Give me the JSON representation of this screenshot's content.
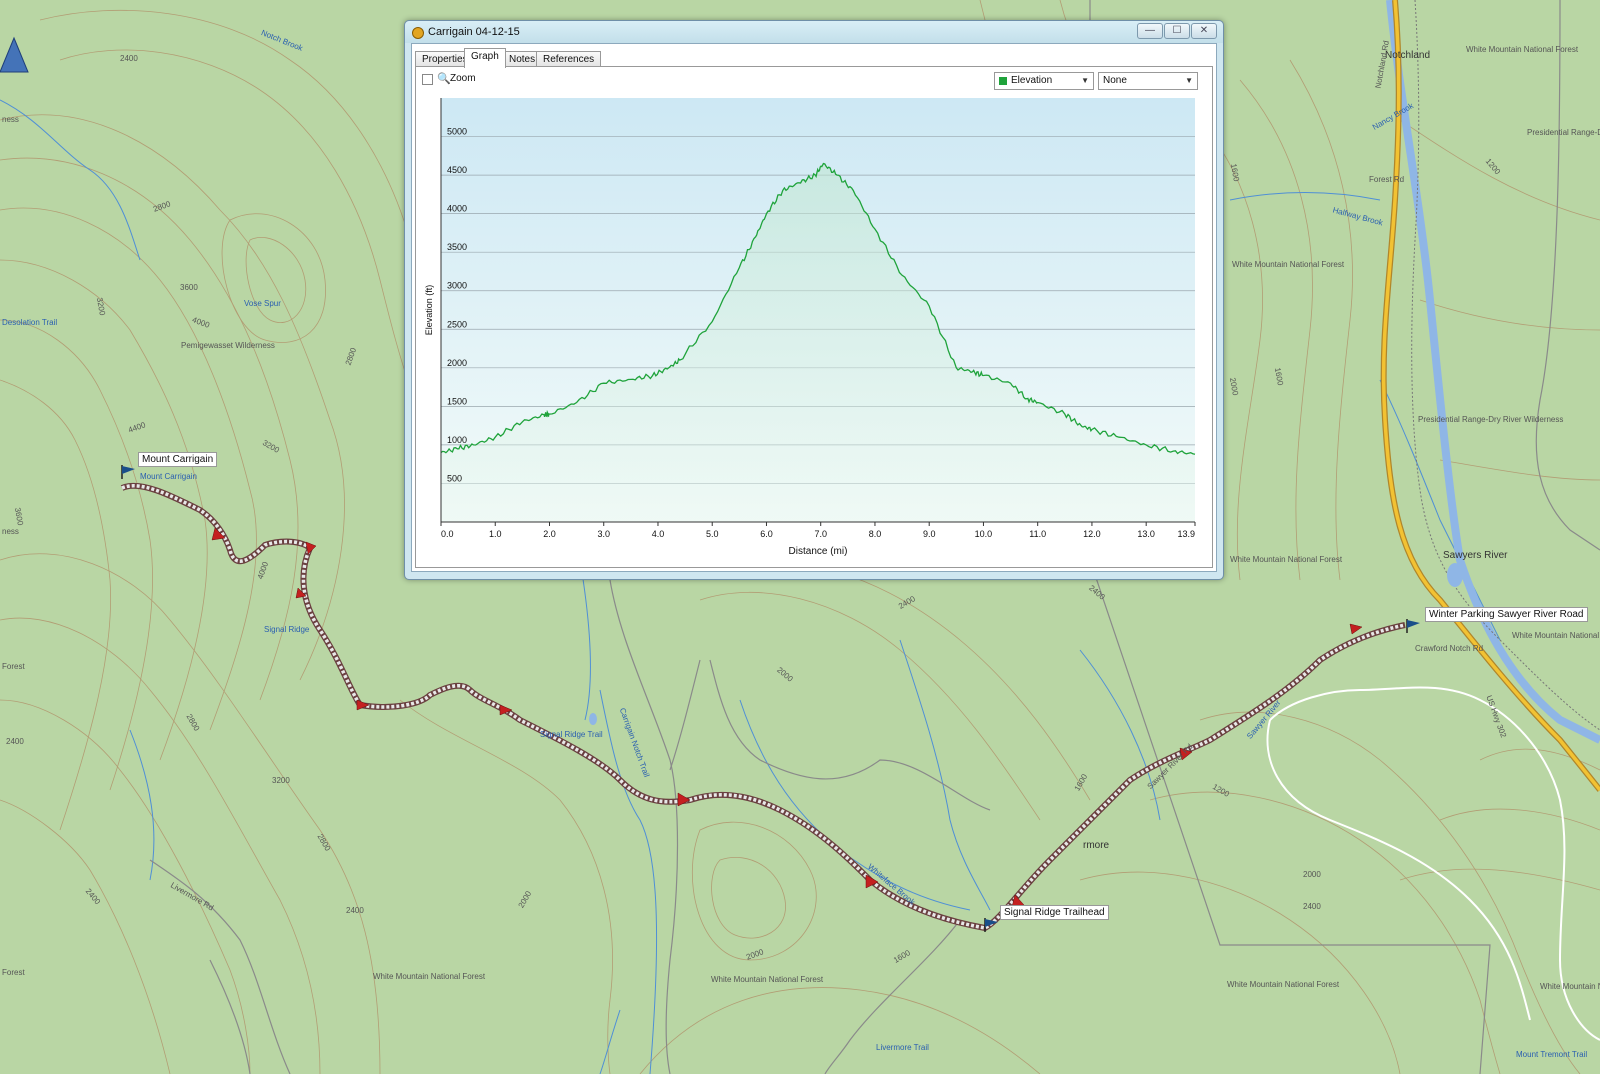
{
  "map": {
    "colors": {
      "land": "#b9d6a4",
      "contour": "#b08a64",
      "stream": "#4f8fd6",
      "road": "#f2c233",
      "track": "#e8e8e8",
      "track_border": "#7a5a5a"
    },
    "labels": {
      "notch_brook": "Notch Brook",
      "e2400a": "2400",
      "e2800a": "2800",
      "e3600": "3600",
      "e4000a": "4000",
      "e3200a": "3200",
      "vose_spur": "Vose Spur",
      "desolation_trail": "Desolation Trail",
      "pemi": "Pemigewasset Wilderness",
      "e2800b": "2800",
      "e4400": "4400",
      "e3200b": "3200",
      "e3600b": "3600",
      "signal_ridge": "Signal Ridge",
      "e4000b": "4000",
      "e2800c": "2800",
      "e2400b": "2400",
      "e3200c": "3200",
      "e2800d": "2800",
      "e2400c": "2400",
      "e2000a": "2000",
      "livermore_rd": "Livermore Rd",
      "wmnf_a": "White Mountain National Forest",
      "wmnf_b": "White Mountain National Forest",
      "wmnf_c": "White Mountain National Forest",
      "wmnf_d": "White Mountain National Forest",
      "wmnf_e": "White Mountain National Forest",
      "wmnf_f": "White Mountain National Forest",
      "wmnf_g": "White Mountain National Forest",
      "wmnf_h": "White Mountain National Forest",
      "e2000b": "2000",
      "e1600a": "1600",
      "livermore_trail": "Livermore Trail",
      "whiteface": "Whiteface Brook",
      "e2400d": "2400",
      "e2000c": "2000",
      "e1600b": "1600",
      "e2000d": "2000",
      "e2400e": "2400",
      "e1200": "1200",
      "notchland": "Notchland",
      "nancy_brook": "Nancy Brook",
      "forest_rd": "Forest Rd",
      "halfway": "Halfway Brook",
      "pres_range": "Presidential Range-Dry River Wilderness",
      "pres_range_b": "Presidential Range-D",
      "e1600c": "1600",
      "e1200b": "1200",
      "sawyers": "Sawyers River",
      "crawford": "Crawford Notch Rd",
      "us302": "US Hwy 302",
      "sawyer_river": "Sawyer River",
      "sawyer_rd": "Sawyer River Rd",
      "mount_tremont": "Mount Tremont Trail",
      "e1600d": "1600",
      "e2000e": "2000",
      "mount_carrigain_blue": "Mount Carrigain",
      "carrigain_n": "Carrigain Notch Trail",
      "ridge_trail": "Signal Ridge Trail",
      "notchland_rd": "Notchland Rd",
      "forest_left_a": "Forest",
      "forest_left_b": "Forest",
      "wilderness_left": "ness",
      "wilderness_left_b": "ness",
      "livermore": "rmore",
      "e3600c": "3600"
    },
    "waypoints": {
      "summit": "Mount Carrigain",
      "trailhead": "Signal Ridge Trailhead",
      "parking": "Winter Parking Sawyer River Road"
    }
  },
  "window": {
    "title": "Carrigain 04-12-15",
    "icon": "gps-app-icon",
    "controls": {
      "minimize": "—",
      "maximize": "☐",
      "close": "✕"
    },
    "tabs": [
      {
        "label": "Properties"
      },
      {
        "label": "Graph"
      },
      {
        "label": "Notes"
      },
      {
        "label": "References"
      }
    ],
    "active_tab": "Graph",
    "zoom_label": "Zoom",
    "zoom_checked": false,
    "dropdown_primary": "Elevation",
    "dropdown_secondary": "None"
  },
  "chart_data": {
    "type": "area",
    "xlabel": "Distance (mi)",
    "ylabel": "Elevation (ft)",
    "xlim": [
      0,
      13.9
    ],
    "ylim": [
      0,
      5500
    ],
    "x_ticks": [
      "0.0",
      "1.0",
      "2.0",
      "3.0",
      "4.0",
      "5.0",
      "6.0",
      "7.0",
      "8.0",
      "9.0",
      "10.0",
      "11.0",
      "12.0",
      "13.0",
      "13.9"
    ],
    "y_ticks": [
      "500",
      "1000",
      "1500",
      "2000",
      "2500",
      "3000",
      "3500",
      "4000",
      "4500",
      "5000"
    ],
    "grid": true,
    "line_color": "#1fa33b",
    "series": [
      {
        "x": [
          0.0,
          0.3,
          0.6,
          1.0,
          1.5,
          1.9,
          2.0,
          2.5,
          3.0,
          3.5,
          3.9,
          4.2,
          4.4,
          5.0,
          5.5,
          5.8,
          6.0,
          6.3,
          6.6,
          6.9,
          7.05,
          7.3,
          7.6,
          8.0,
          8.5,
          9.0,
          9.5,
          9.8,
          10.0,
          10.5,
          10.8,
          11.0,
          11.5,
          11.8,
          12.0,
          12.5,
          13.0,
          13.5,
          13.9
        ],
        "y": [
          900,
          950,
          1000,
          1100,
          1300,
          1390,
          1400,
          1550,
          1800,
          1850,
          1900,
          2000,
          2100,
          2600,
          3300,
          3700,
          4000,
          4300,
          4400,
          4500,
          4650,
          4500,
          4300,
          3800,
          3200,
          2800,
          2000,
          1950,
          1900,
          1800,
          1600,
          1550,
          1400,
          1250,
          1200,
          1100,
          1000,
          920,
          880
        ]
      }
    ]
  }
}
